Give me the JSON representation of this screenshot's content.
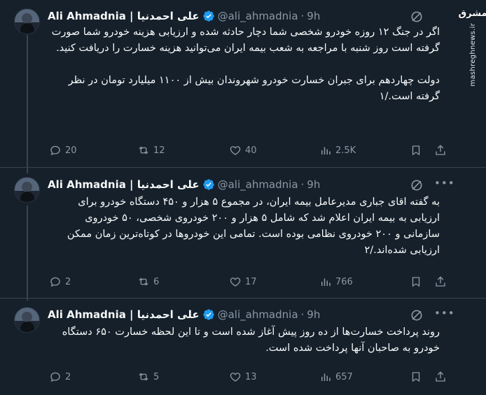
{
  "tweets": [
    {
      "name": "Ali Ahmadnia | علی احمدنیا",
      "handle": "@ali_ahmadnia",
      "dot": "·",
      "time": "9h",
      "text": "اگر در جنگ ۱۲ روزه خودرو شخصی شما دچار حادثه شده و ارزیابی هزینه خودرو شما صورت گرفته است روز شنبه با مراجعه به شعب بیمه ایران می‌توانید هزینه خسارت را دریافت کنید.\n\nدولت چهاردهم برای جبران خسارت خودرو شهروندان بیش از ۱۱۰۰ میلیارد تومان در نظر گرفته است./۱",
      "replies": "20",
      "reposts": "12",
      "likes": "40",
      "views": "2.5K"
    },
    {
      "name": "Ali Ahmadnia | علی احمدنیا",
      "handle": "@ali_ahmadnia",
      "dot": "·",
      "time": "9h",
      "text": "به گفته اقای جباری مدیرعامل بیمه ایران، در مجموع ۵ هزار و ۴۵۰ دستگاه خودرو برای ارزیابی به بیمه ایران اعلام شد که شامل ۵ هزار و ۲۰۰ خودروی شخصی، ۵۰ خودروی سازمانی و ۲۰۰ خودروی نظامی بوده است. تمامی این خودروها در کوتاه‌ترین زمان ممکن ارزیابی شده‌اند./۲",
      "replies": "2",
      "reposts": "6",
      "likes": "17",
      "views": "766"
    },
    {
      "name": "Ali Ahmadnia | علی احمدنیا",
      "handle": "@ali_ahmadnia",
      "dot": "·",
      "time": "9h",
      "text": "روند پرداخت خسارت‌ها از ده روز پیش آغاز شده است و تا این لحظه خسارت ۶۵۰ دستگاه خودرو به صاحبان آنها پرداخت شده است.",
      "replies": "2",
      "reposts": "5",
      "likes": "13",
      "views": "657"
    }
  ],
  "watermark": {
    "logo_text": "مشرق",
    "url": "mashreghnews.ir"
  },
  "colors": {
    "background": "#15202b",
    "text": "#f7f9f9",
    "muted": "#8b98a5",
    "verified": "#1d9bf0",
    "divider": "#38444d"
  }
}
